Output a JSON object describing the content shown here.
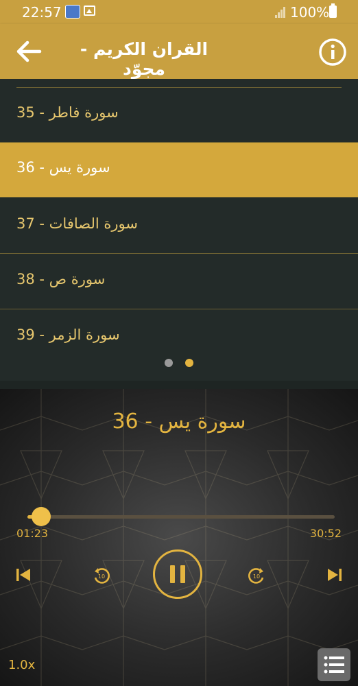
{
  "status_bar": {
    "time": "22:57",
    "battery": "100%"
  },
  "app_bar": {
    "title": "القران الكريم - مجوّد",
    "back_icon": "arrow-back-icon",
    "info_icon": "info-icon"
  },
  "list": {
    "items": [
      {
        "label": "سورة فاطر - 35",
        "selected": false
      },
      {
        "label": "سورة يس - 36",
        "selected": true
      },
      {
        "label": "سورة الصافات - 37",
        "selected": false
      },
      {
        "label": "سورة ص - 38",
        "selected": false
      },
      {
        "label": "سورة الزمر - 39",
        "selected": false
      }
    ],
    "page_indicator": {
      "pages": 2,
      "current": 2
    }
  },
  "player": {
    "now_playing": "سورة يس - 36",
    "current_time": "01:23",
    "total_time": "30:52",
    "progress": 0.045,
    "speed": "1.0x",
    "rewind_seconds": "10",
    "forward_seconds": "10"
  },
  "colors": {
    "accent": "#c8a040",
    "gold_text": "#e3b440",
    "list_bg": "#232b29"
  }
}
